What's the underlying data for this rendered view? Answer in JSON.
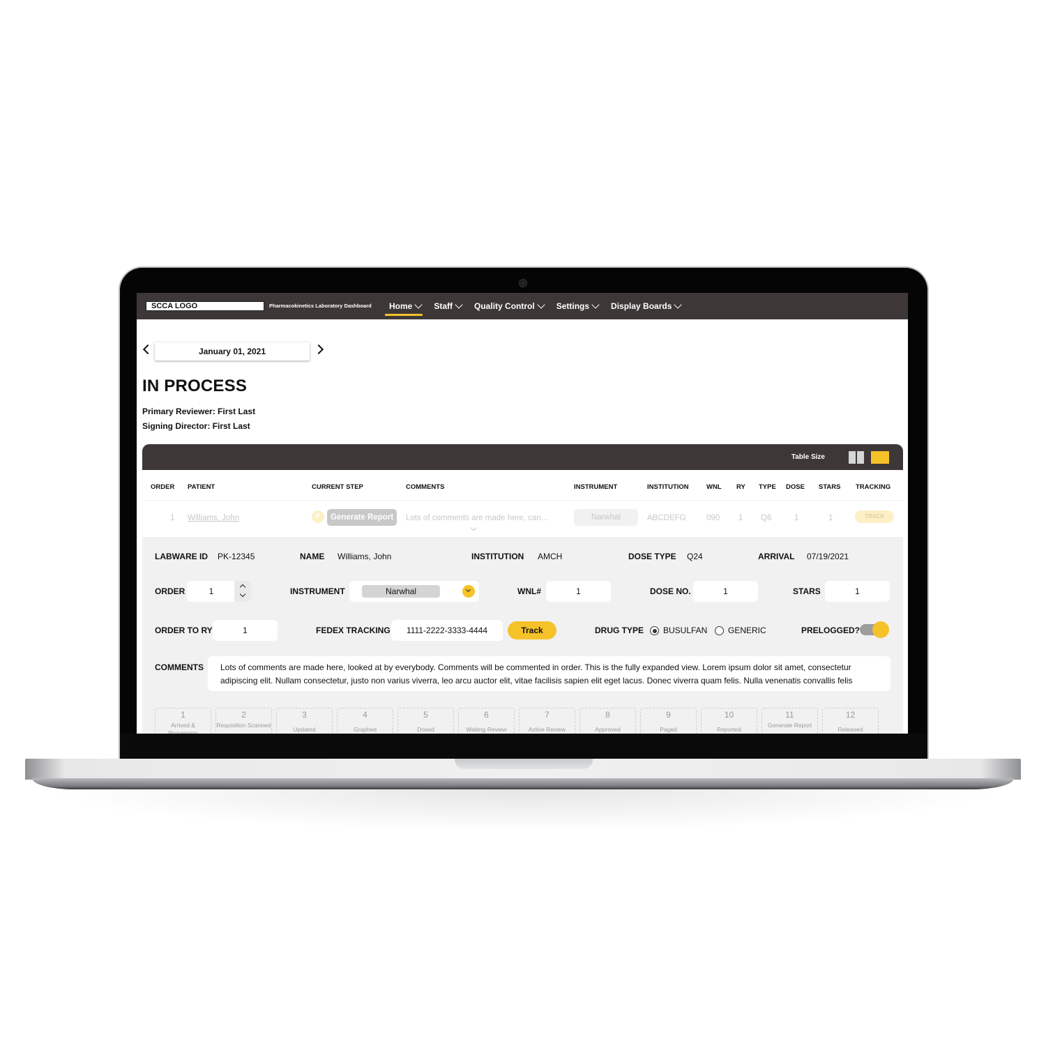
{
  "app": {
    "logo_text": "SCCA LOGO",
    "title": "Pharmacokinetics Laboratory Dashboard"
  },
  "nav": {
    "items": [
      {
        "label": "Home",
        "active": true
      },
      {
        "label": "Staff",
        "active": false
      },
      {
        "label": "Quality Control",
        "active": false
      },
      {
        "label": "Settings",
        "active": false
      },
      {
        "label": "Display Boards",
        "active": false
      }
    ]
  },
  "date_picker": {
    "value": "January 01, 2021",
    "prev_icon": "chevron-left-icon",
    "next_icon": "chevron-right-icon"
  },
  "page": {
    "title": "IN PROCESS",
    "primary_reviewer": "Primary Reviewer: First Last",
    "signing_director": "Signing Director: First Last"
  },
  "table": {
    "size_label": "Table Size",
    "size_options": [
      "compact",
      "full"
    ],
    "size_selected": "full",
    "columns": [
      "ORDER",
      "PATIENT",
      "CURRENT STEP",
      "COMMENTS",
      "INSTRUMENT",
      "INSTITUTION",
      "WNL",
      "RY",
      "TYPE",
      "DOSE",
      "STARS",
      "TRACKING"
    ],
    "rows": [
      {
        "order": "1",
        "patient": "Williams, John",
        "step_badge": "P",
        "current_step": "Generate Report",
        "comments": "Lots of comments are made here, can…",
        "instrument": "Narwhal",
        "institution": "ABCDEFG",
        "wnl": "090",
        "ry": "1",
        "type": "Q6",
        "dose": "1",
        "stars": "1",
        "tracking": "TRACK"
      }
    ]
  },
  "detail": {
    "labware_id_label": "LABWARE ID",
    "labware_id": "PK-12345",
    "name_label": "NAME",
    "name": "Williams, John",
    "institution_label": "INSTITUTION",
    "institution": "AMCH",
    "dose_type_label": "DOSE TYPE",
    "dose_type": "Q24",
    "arrival_label": "ARRIVAL",
    "arrival": "07/19/2021",
    "order_label": "ORDER",
    "order": "1",
    "instrument_label": "INSTRUMENT",
    "instrument": "Narwhal",
    "wnl_label": "WNL#",
    "wnl": "1",
    "dose_no_label": "DOSE NO.",
    "dose_no": "1",
    "stars_label": "STARS",
    "stars": "1",
    "order_to_ry_label": "ORDER TO RY",
    "order_to_ry": "1",
    "fedex_label": "FEDEX TRACKING",
    "fedex": "1111-2222-3333-4444",
    "track_button": "Track",
    "drug_type_label": "DRUG TYPE",
    "drug_options": [
      {
        "label": "BUSULFAN",
        "checked": true
      },
      {
        "label": "GENERIC",
        "checked": false
      }
    ],
    "prelogged_label": "PRELOGGED?",
    "prelogged": true,
    "comments_label": "COMMENTS",
    "comments": "Lots of comments are made here, looked at by everybody. Comments will be commented in order. This is the fully expanded view. Lorem ipsum dolor sit amet, consectetur adipiscing elit. Nullam consectetur, justo non varius viverra, leo arcu auctor elit, vitae facilisis sapien elit eget lacus. Donec viverra quam felis. Nulla venenatis convallis felis"
  },
  "steps": [
    {
      "num": "1",
      "name": "Arrived & Processing"
    },
    {
      "num": "2",
      "name": "Requisition Scanned"
    },
    {
      "num": "3",
      "name": "Updated"
    },
    {
      "num": "4",
      "name": "Graphed"
    },
    {
      "num": "5",
      "name": "Dosed"
    },
    {
      "num": "6",
      "name": "Waiting Review"
    },
    {
      "num": "7",
      "name": "Active Review"
    },
    {
      "num": "8",
      "name": "Approved"
    },
    {
      "num": "9",
      "name": "Paged"
    },
    {
      "num": "10",
      "name": "Reported"
    },
    {
      "num": "11",
      "name": "Generate Report"
    },
    {
      "num": "12",
      "name": "Released"
    }
  ],
  "colors": {
    "accent": "#f6c22a",
    "header_bg": "#3d3737",
    "detail_bg": "#f1f1f1"
  }
}
